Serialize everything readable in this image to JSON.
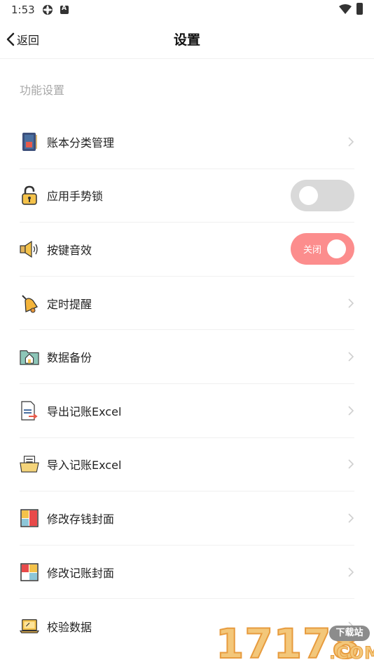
{
  "status_bar": {
    "time": "1:53"
  },
  "nav": {
    "back_label": "返回",
    "title": "设置"
  },
  "section": {
    "title": "功能设置"
  },
  "rows": [
    {
      "label": "账本分类管理",
      "icon": "ledger-book-icon",
      "control": "chevron"
    },
    {
      "label": "应用手势锁",
      "icon": "padlock-icon",
      "control": "toggle",
      "toggle_on": false
    },
    {
      "label": "按键音效",
      "icon": "speaker-icon",
      "control": "toggle",
      "toggle_on": true,
      "toggle_text": "关闭"
    },
    {
      "label": "定时提醒",
      "icon": "bell-icon",
      "control": "chevron"
    },
    {
      "label": "数据备份",
      "icon": "folder-home-icon",
      "control": "chevron"
    },
    {
      "label": "导出记账Excel",
      "icon": "export-document-icon",
      "control": "chevron"
    },
    {
      "label": "导入记账Excel",
      "icon": "import-folder-icon",
      "control": "chevron"
    },
    {
      "label": "修改存钱封面",
      "icon": "savings-cover-icon",
      "control": "chevron"
    },
    {
      "label": "修改记账封面",
      "icon": "ledger-cover-icon",
      "control": "chevron"
    },
    {
      "label": "校验数据",
      "icon": "laptop-check-icon",
      "control": "chevron"
    }
  ],
  "watermark": {
    "digits": "17178",
    "badge": "下载站",
    "suffix": ".COM"
  },
  "colors": {
    "toggle_on": "#fc8d8d",
    "toggle_off": "#d9d9d9",
    "section_title": "#a8a8a8"
  }
}
